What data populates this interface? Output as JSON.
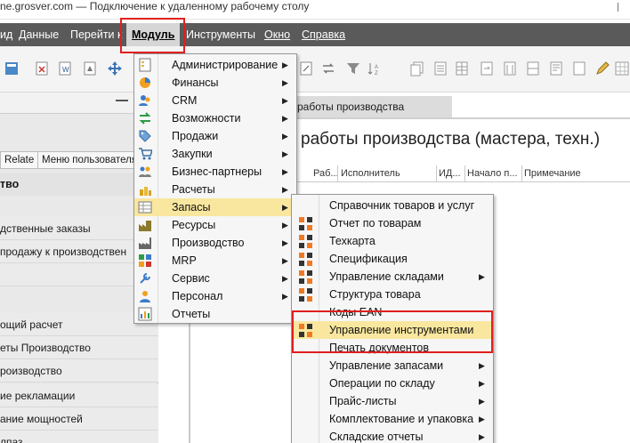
{
  "window": {
    "title": "ne.grosver.com — Подключение к удаленному рабочему столу"
  },
  "menubar": {
    "items": [
      {
        "key": "view",
        "label": "ид"
      },
      {
        "key": "data",
        "label": "Данные"
      },
      {
        "key": "goto",
        "label": "Перейти к"
      },
      {
        "key": "module",
        "label": "Модуль"
      },
      {
        "key": "tools",
        "label": "Инструменты"
      },
      {
        "key": "window",
        "label": "Окно"
      },
      {
        "key": "help",
        "label": "Справка"
      }
    ]
  },
  "left_panel": {
    "tabs": [
      "Relate",
      "Меню пользователя"
    ],
    "heading": "тво",
    "items": [
      "дственные заказы",
      "продажу к производствен",
      "",
      "ощий расчет",
      "еты Производство",
      "роизводство",
      "ие рекламации",
      "ание мощностей",
      "лпаз"
    ]
  },
  "main": {
    "doc_tab": "работы производства",
    "title": "работы производства (мастера, техн.)",
    "columns": [
      "Раб...",
      "Исполнитель",
      "ИД...",
      "Начало п...",
      "Примечание"
    ]
  },
  "module_menu": {
    "items": [
      {
        "label": "Администрирование",
        "icon": "admin-icon"
      },
      {
        "label": "Финансы",
        "icon": "finance-icon"
      },
      {
        "label": "CRM",
        "icon": "crm-icon"
      },
      {
        "label": "Возможности",
        "icon": "opportunities-icon"
      },
      {
        "label": "Продажи",
        "icon": "sales-icon"
      },
      {
        "label": "Закупки",
        "icon": "purchasing-icon"
      },
      {
        "label": "Бизнес-партнеры",
        "icon": "partners-icon"
      },
      {
        "label": "Расчеты",
        "icon": "payments-icon"
      },
      {
        "label": "Запасы",
        "icon": "inventory-icon"
      },
      {
        "label": "Ресурсы",
        "icon": "resources-icon"
      },
      {
        "label": "Производство",
        "icon": "production-icon"
      },
      {
        "label": "MRP",
        "icon": "mrp-icon"
      },
      {
        "label": "Сервис",
        "icon": "service-icon"
      },
      {
        "label": "Персонал",
        "icon": "personnel-icon"
      },
      {
        "label": "Отчеты",
        "icon": "reports-icon"
      }
    ],
    "highlighted": "Запасы"
  },
  "inventory_submenu": {
    "items": [
      {
        "label": "Справочник товаров и услуг",
        "submenu": false,
        "icon": false
      },
      {
        "label": "Отчет по товарам",
        "submenu": false,
        "icon": true
      },
      {
        "label": "Техкарта",
        "submenu": false,
        "icon": true
      },
      {
        "label": "Спецификация",
        "submenu": false,
        "icon": true
      },
      {
        "label": "Управление складами",
        "submenu": true,
        "icon": true
      },
      {
        "label": "Структура товара",
        "submenu": false,
        "icon": true
      },
      {
        "label": "Коды EAN",
        "submenu": false,
        "icon": false
      },
      {
        "label": "Управление инструментами",
        "submenu": false,
        "icon": true
      },
      {
        "label": "Печать документов",
        "submenu": false,
        "icon": false
      },
      {
        "label": "Управление запасами",
        "submenu": true,
        "icon": false
      },
      {
        "label": "Операции по складу",
        "submenu": true,
        "icon": false
      },
      {
        "label": "Прайс-листы",
        "submenu": true,
        "icon": false
      },
      {
        "label": "Комплектование и упаковка",
        "submenu": true,
        "icon": false
      },
      {
        "label": "Складские отчеты",
        "submenu": true,
        "icon": false
      }
    ],
    "highlighted": "Управление инструментами"
  },
  "colors": {
    "menubar": "#5a5a5a",
    "highlight": "#f9e79f",
    "annotation_red": "#e01f1f",
    "accent_orange": "#f07a23"
  }
}
